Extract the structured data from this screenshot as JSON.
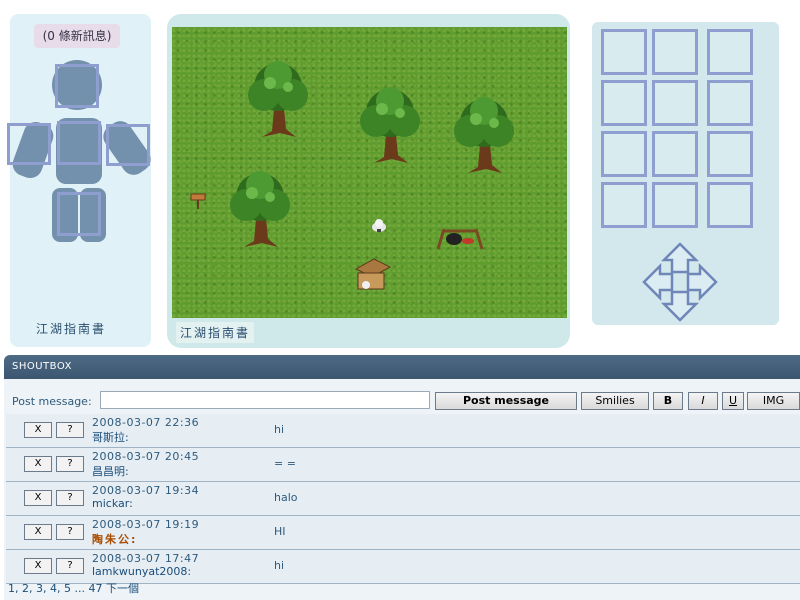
{
  "character": {
    "messages_badge": "(0 條新訊息)",
    "guide_label": "江湖指南書"
  },
  "map": {
    "guide_label": "江湖指南書"
  },
  "inventory": {
    "slot_count": 12
  },
  "shoutbox": {
    "title": "SHOUTBOX",
    "post_label": "Post message:",
    "post_value": "",
    "buttons": {
      "post": "Post message",
      "smilies": "Smilies",
      "bold": "B",
      "italic": "I",
      "underline": "U",
      "img": "IMG"
    },
    "row_buttons": {
      "delete": "X",
      "info": "?"
    },
    "messages": [
      {
        "date": "2008-03-07  22:36",
        "user": "哥斯拉:",
        "text": "hi",
        "special": false
      },
      {
        "date": "2008-03-07  20:45",
        "user": "昌昌明:",
        "text": "= =",
        "special": false
      },
      {
        "date": "2008-03-07  19:34",
        "user": "mickar:",
        "text": "halo",
        "special": false
      },
      {
        "date": "2008-03-07  19:19",
        "user": "陶朱公:",
        "text": "HI",
        "special": true
      },
      {
        "date": "2008-03-07  17:47",
        "user": "lamkwunyat2008:",
        "text": "hi",
        "special": false
      }
    ],
    "pager": "1, 2, 3, 4, 5 ... 47 下一個"
  },
  "colors": {
    "panel_bg": "#e0f2f7",
    "slot_border": "#8e9fcf",
    "header_bg": "#3c5670",
    "grass": "#5f9c2f"
  }
}
